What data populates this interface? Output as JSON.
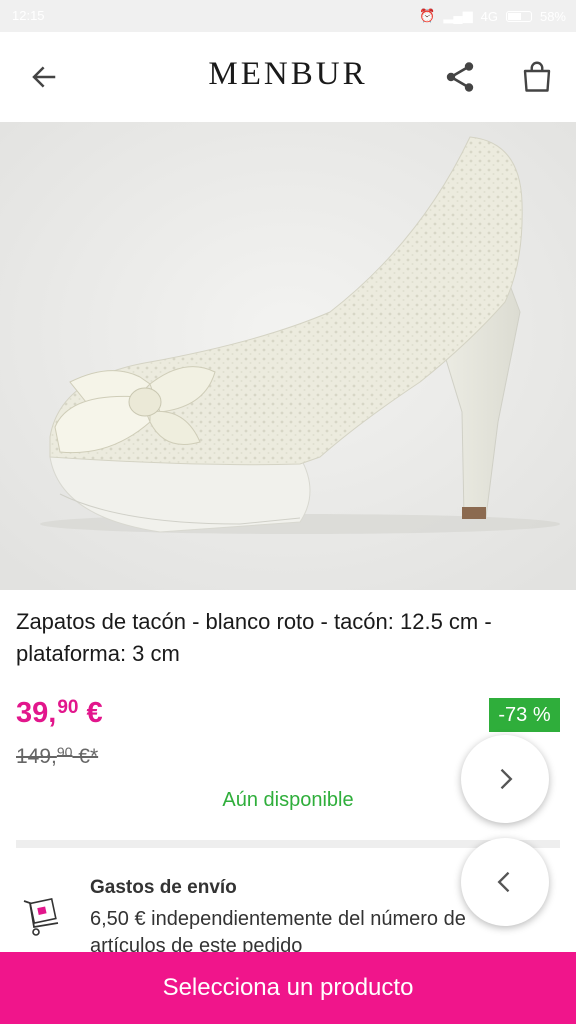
{
  "status_bar": {
    "time": "12:15",
    "network": "4G",
    "battery": "58%"
  },
  "header": {
    "brand": "MENBUR",
    "icons": {
      "back": "arrow-left-icon",
      "share": "share-icon",
      "cart": "shopping-bag-icon"
    }
  },
  "product": {
    "title": "Zapatos de tacón - blanco roto - tacón: 12.5 cm - plataforma: 3 cm",
    "price": {
      "whole": "39,",
      "cents": "90",
      "currency": " €"
    },
    "old_price": {
      "whole": "149,",
      "cents": "90",
      "suffix": " €*"
    },
    "discount": "-73 %",
    "availability": "Aún disponible"
  },
  "shipping": {
    "title": "Gastos de envío",
    "text": "6,50 € independientemente del número de artículos de este pedido"
  },
  "cta": {
    "label": "Selecciona un producto"
  },
  "colors": {
    "accent": "#f0158b",
    "price": "#e2168c",
    "success": "#2fae3b"
  }
}
